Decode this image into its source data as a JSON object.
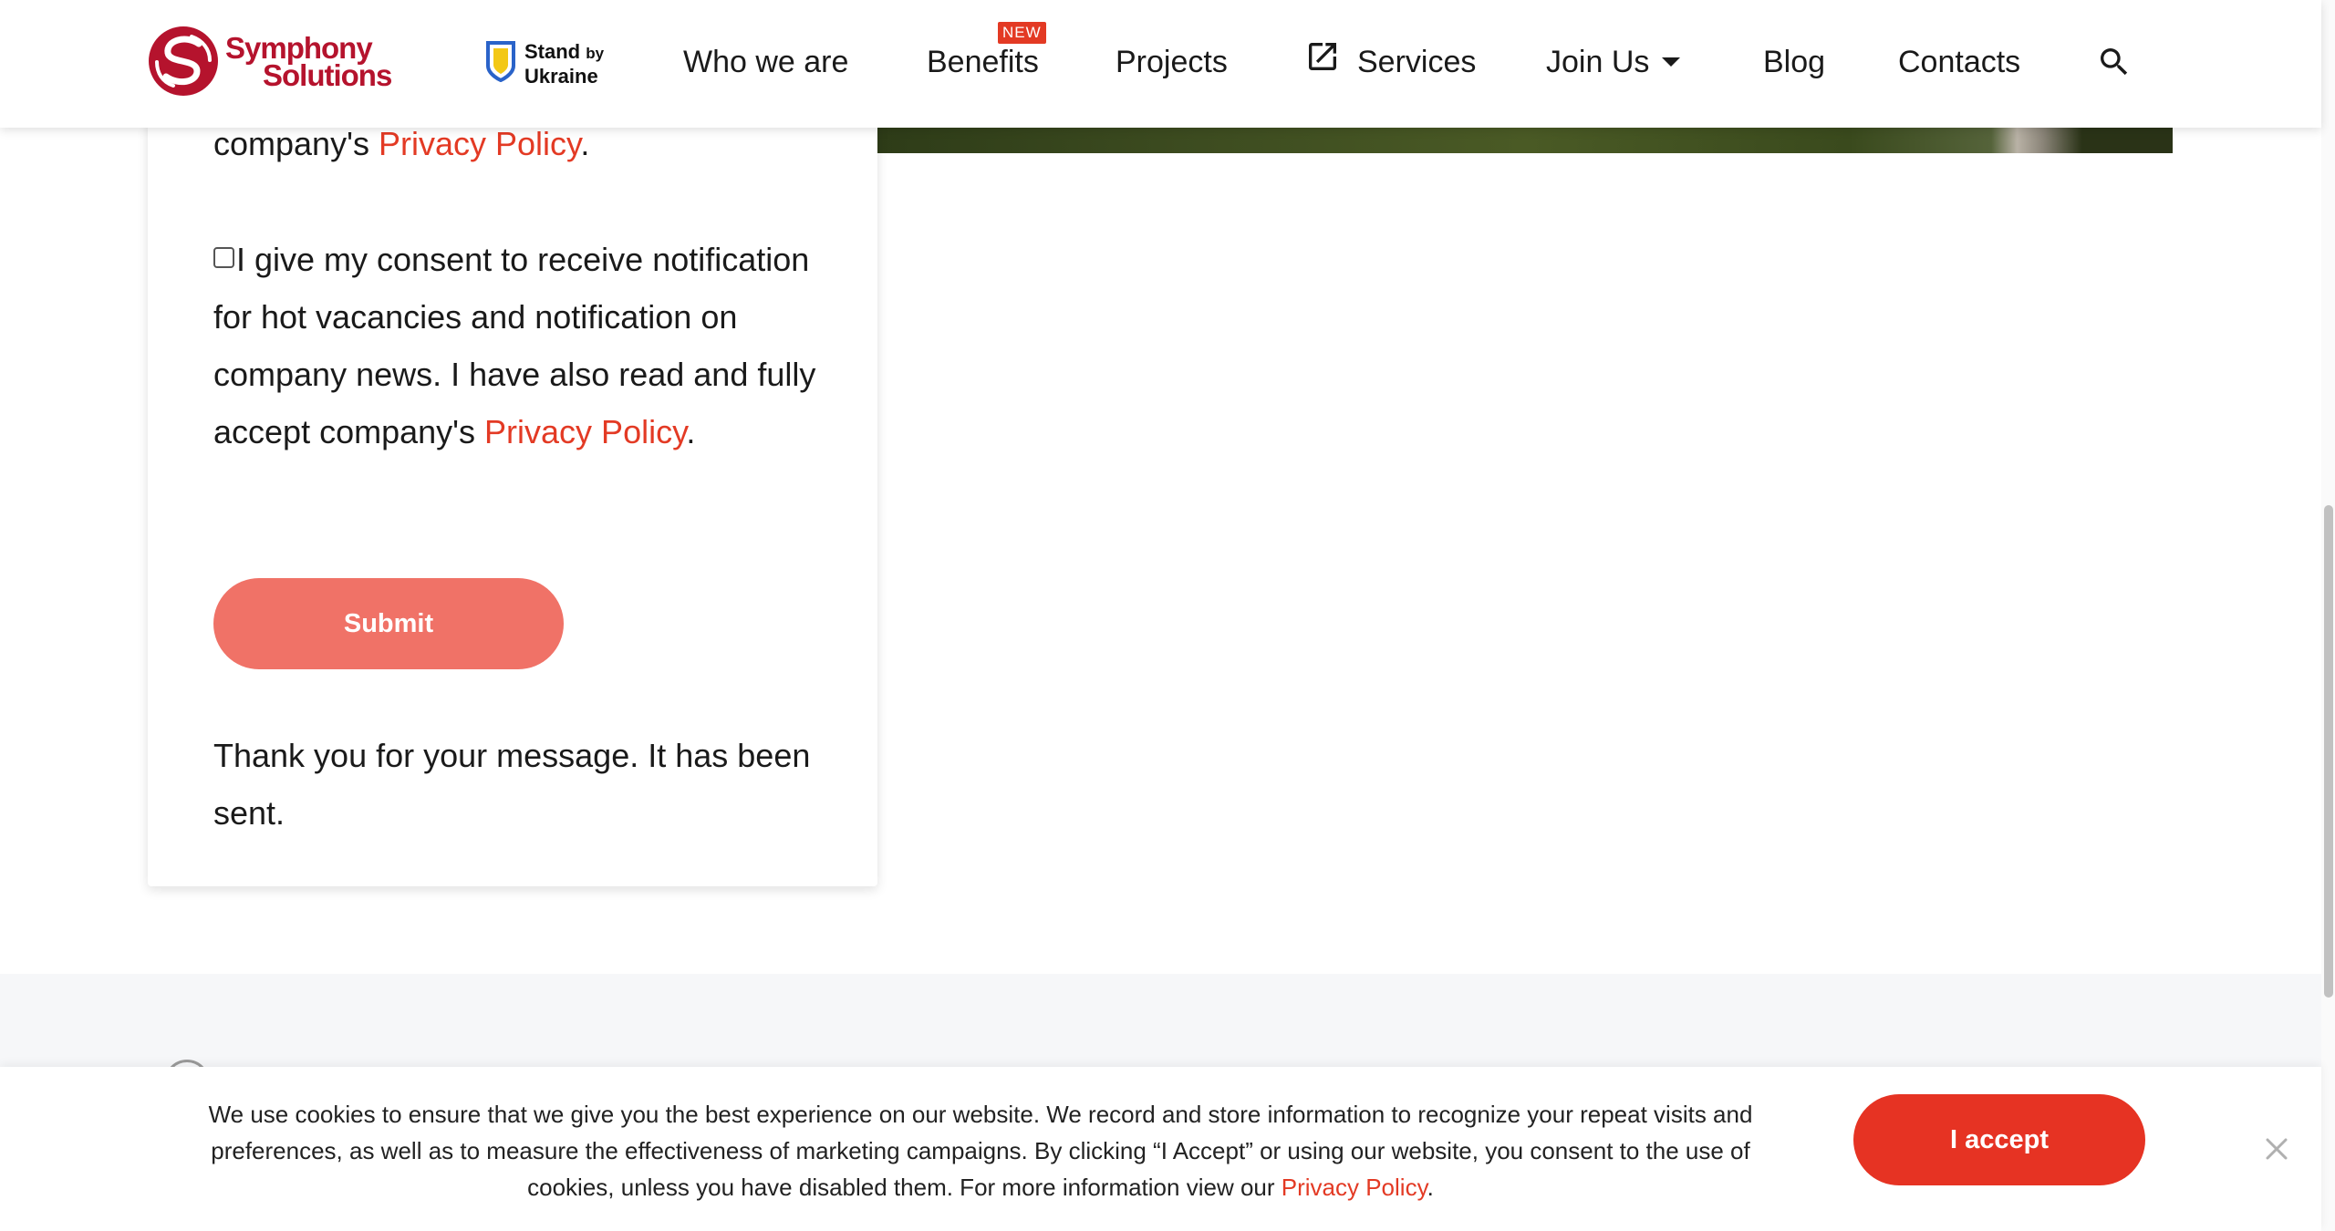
{
  "header": {
    "logo": {
      "line1": "Symphony",
      "line2": "Solutions",
      "icon": "symphony-solutions-logo"
    },
    "stand_badge": {
      "line1": "Stand",
      "by": "by",
      "line2": "Ukraine",
      "icon": "ukraine-shield-icon"
    },
    "nav": {
      "who": "Who we are",
      "benefits": "Benefits",
      "benefits_badge": "NEW",
      "projects": "Projects",
      "services": "Services",
      "join": "Join Us",
      "blog": "Blog",
      "contacts": "Contacts"
    },
    "icons": {
      "services": "external-link-icon",
      "join": "caret-down-icon",
      "search": "search-icon"
    }
  },
  "form": {
    "privacy_prefix": "company's ",
    "privacy_link": "Privacy Policy",
    "period": ".",
    "consent_text": "I give my consent to receive notification for hot vacancies and notification on company news. I have also read and fully accept company's ",
    "consent_link": "Privacy Policy",
    "consent_checked": false,
    "submit_label": "Submit",
    "thanks": "Thank you for your message. It has been sent."
  },
  "cookie": {
    "text": "We use cookies to ensure that we give you the best experience on our website. We record and store information to recognize your repeat visits and preferences, as well as to measure the effectiveness of marketing campaigns. By clicking “I Accept” or using our website, you consent to the use of cookies, unless you have disabled them. For more information view our ",
    "link": "Privacy Policy",
    "period": ".",
    "accept_label": "I accept"
  },
  "colors": {
    "brand_red": "#e33a24",
    "submit_bg": "#f07267",
    "accept_bg": "#e63323",
    "logo_red": "#b5132d"
  }
}
